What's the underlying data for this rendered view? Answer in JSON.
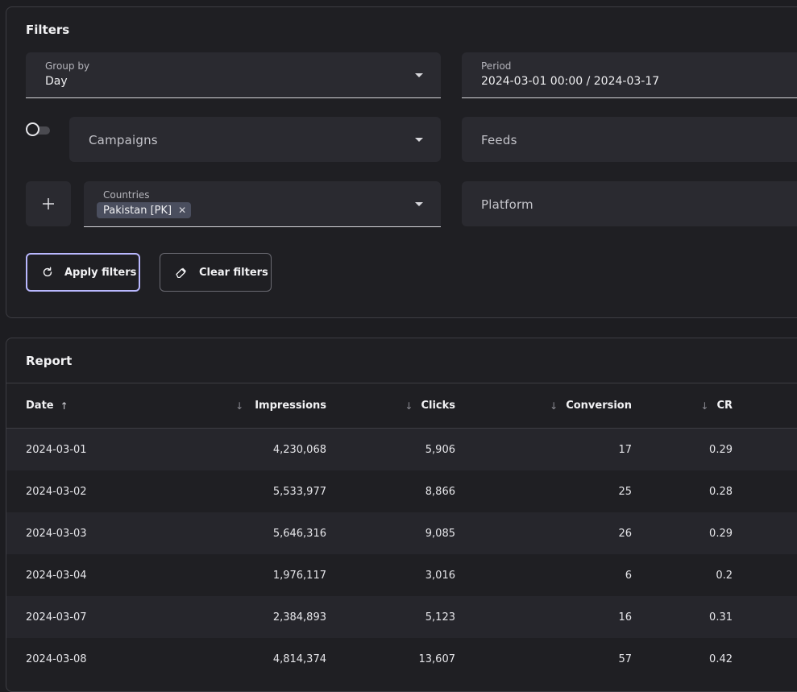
{
  "filters": {
    "title": "Filters",
    "group_by": {
      "label": "Group by",
      "value": "Day"
    },
    "period": {
      "label": "Period",
      "value": "2024-03-01 00:00 / 2024-03-17"
    },
    "campaigns": {
      "placeholder": "Campaigns"
    },
    "feeds": {
      "placeholder": "Feeds"
    },
    "countries": {
      "label": "Countries",
      "chips": [
        "Pakistan [PK]"
      ]
    },
    "platform": {
      "placeholder": "Platform"
    },
    "apply_label": "Apply filters",
    "clear_label": "Clear filters",
    "accent_color": "#b9b8ff"
  },
  "report": {
    "title": "Report",
    "columns": [
      "Date",
      "Impressions",
      "Clicks",
      "Conversion",
      "CR"
    ],
    "rows": [
      [
        "2024-03-01",
        "4,230,068",
        "5,906",
        "17",
        "0.29"
      ],
      [
        "2024-03-02",
        "5,533,977",
        "8,866",
        "25",
        "0.28"
      ],
      [
        "2024-03-03",
        "5,646,316",
        "9,085",
        "26",
        "0.29"
      ],
      [
        "2024-03-04",
        "1,976,117",
        "3,016",
        "6",
        "0.2"
      ],
      [
        "2024-03-07",
        "2,384,893",
        "5,123",
        "16",
        "0.31"
      ],
      [
        "2024-03-08",
        "4,814,374",
        "13,607",
        "57",
        "0.42"
      ]
    ]
  }
}
